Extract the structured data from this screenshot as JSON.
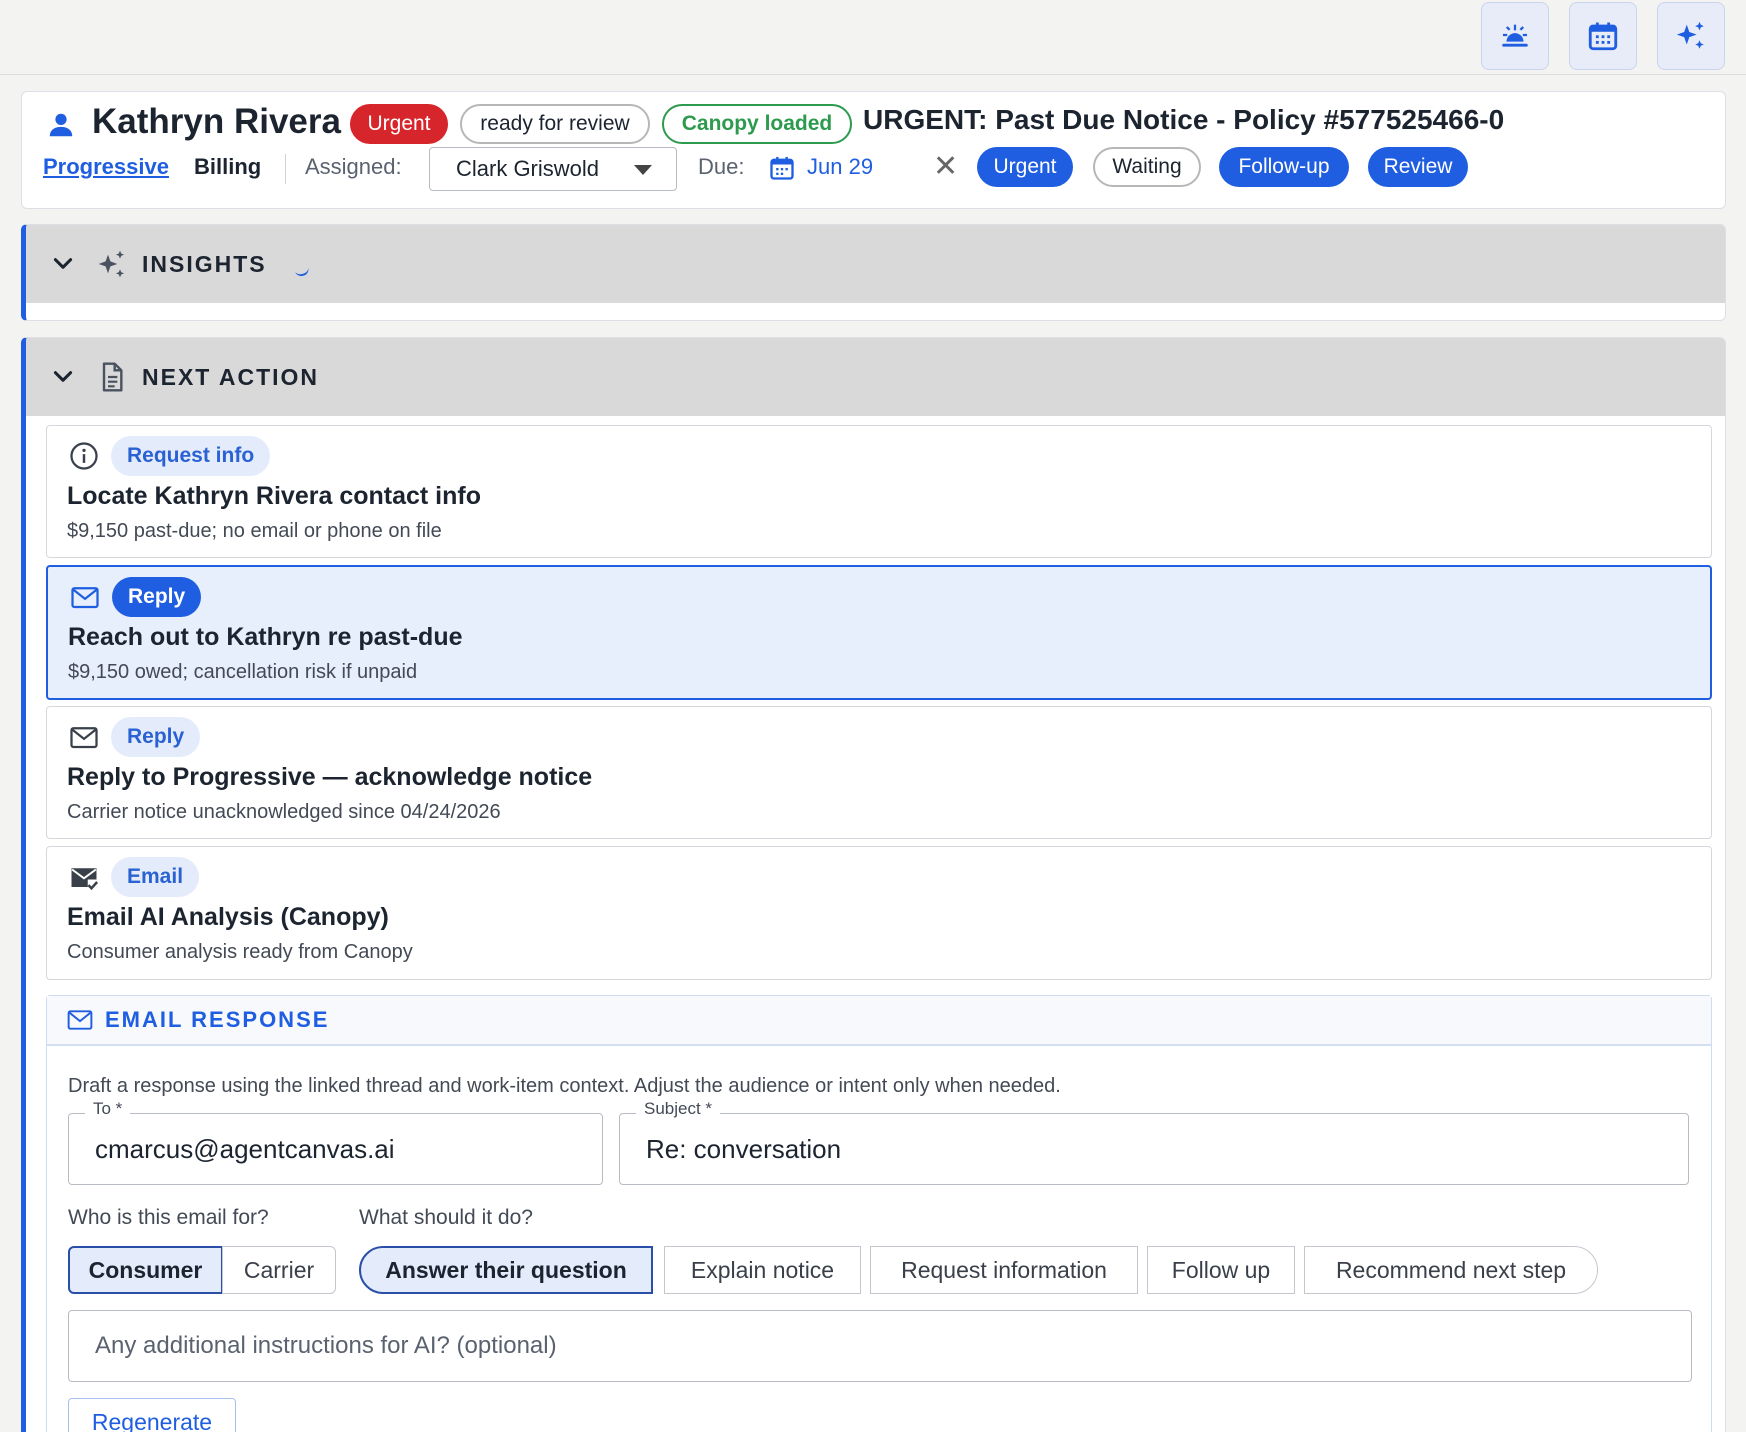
{
  "toolbar": {
    "icons": [
      "sunrise-icon",
      "calendar-icon",
      "sparkles-icon"
    ]
  },
  "header": {
    "name": "Kathryn Rivera",
    "badges": {
      "urgent": "Urgent",
      "status": "ready for review",
      "canopy": "Canopy loaded"
    },
    "title": "URGENT: Past Due Notice - Policy #577525466-0",
    "carrier": "Progressive",
    "department": "Billing",
    "assigned_label": "Assigned:",
    "assigned_value": "Clark Griswold",
    "due_label": "Due:",
    "due_date": "Jun 29",
    "clear": "✕",
    "tags": [
      "Urgent",
      "Waiting",
      "Follow-up",
      "Review"
    ]
  },
  "insights": {
    "title": "INSIGHTS"
  },
  "next_action": {
    "title": "NEXT ACTION",
    "items": [
      {
        "icon": "info-icon",
        "chip": "Request info",
        "title": "Locate Kathryn Rivera contact info",
        "subtitle": "$9,150 past-due; no email or phone on file"
      },
      {
        "icon": "mail-icon",
        "chip": "Reply",
        "title": "Reach out to Kathryn re past-due",
        "subtitle": "$9,150 owed; cancellation risk if unpaid"
      },
      {
        "icon": "mail-icon",
        "chip": "Reply",
        "title": "Reply to Progressive — acknowledge notice",
        "subtitle": "Carrier notice unacknowledged since 04/24/2026"
      },
      {
        "icon": "mail-check-icon",
        "chip": "Email",
        "title": "Email AI Analysis (Canopy)",
        "subtitle": "Consumer analysis ready from Canopy"
      }
    ]
  },
  "email_response": {
    "title": "EMAIL RESPONSE",
    "description": "Draft a response using the linked thread and work-item context. Adjust the audience or intent only when needed.",
    "to_label": "To *",
    "to_value": "cmarcus@agentcanvas.ai",
    "subject_label": "Subject *",
    "subject_value": "Re: conversation",
    "audience_label": "Who is this email for?",
    "audience_options": [
      "Consumer",
      "Carrier"
    ],
    "audience_selected": "Consumer",
    "intent_label": "What should it do?",
    "intent_options": [
      "Answer their question",
      "Explain notice",
      "Request information",
      "Follow up",
      "Recommend next step"
    ],
    "intent_selected": "Answer their question",
    "instructions_placeholder": "Any additional instructions for AI? (optional)",
    "regenerate_label": "Regenerate"
  },
  "colors": {
    "accent": "#1f5ee0",
    "urgent": "#d6262b",
    "success": "#2d9a4e",
    "selected_bg": "#e7eefc"
  }
}
